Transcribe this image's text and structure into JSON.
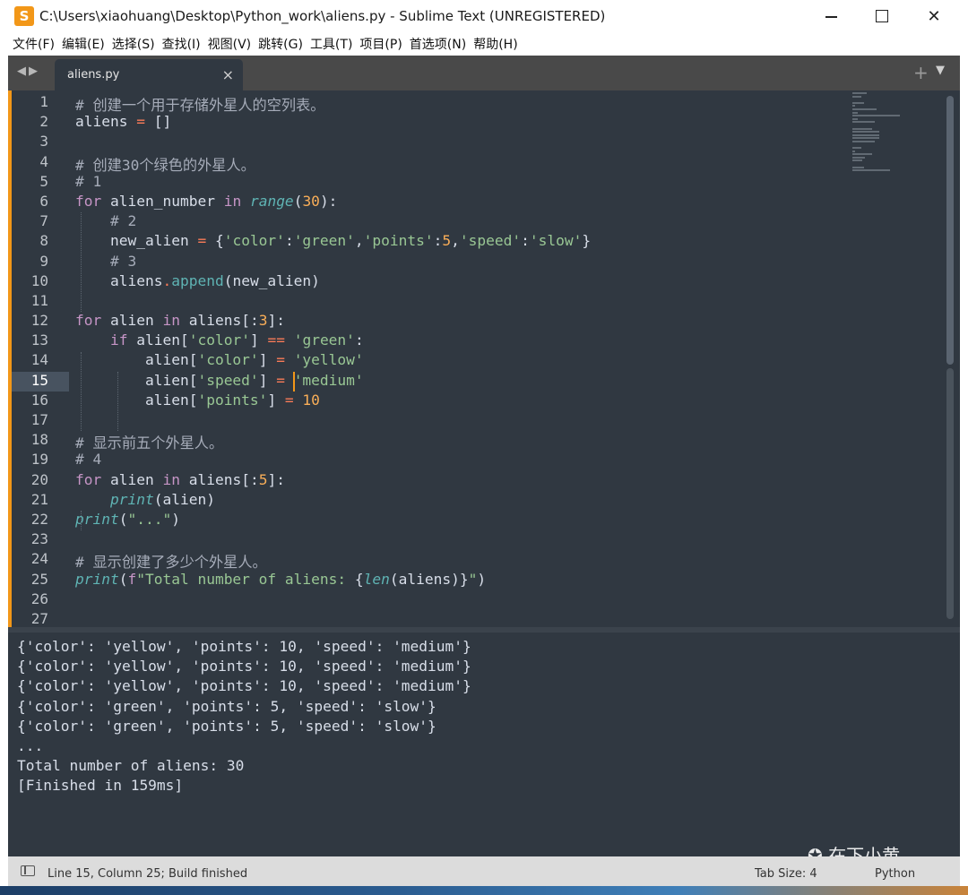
{
  "window": {
    "title": "C:\\Users\\xiaohuang\\Desktop\\Python_work\\aliens.py - Sublime Text (UNREGISTERED)",
    "app_icon": "S"
  },
  "menu": {
    "items": [
      "文件(F)",
      "编辑(E)",
      "选择(S)",
      "查找(I)",
      "视图(V)",
      "跳转(G)",
      "工具(T)",
      "项目(P)",
      "首选项(N)",
      "帮助(H)"
    ]
  },
  "tabs": [
    {
      "label": "aliens.py",
      "active": true
    }
  ],
  "editor": {
    "active_line": 15,
    "line_numbers": [
      "1",
      "2",
      "3",
      "4",
      "5",
      "6",
      "7",
      "8",
      "9",
      "10",
      "11",
      "12",
      "13",
      "14",
      "15",
      "16",
      "17",
      "18",
      "19",
      "20",
      "21",
      "22",
      "23",
      "24",
      "25",
      "26",
      "27"
    ],
    "lines": [
      [
        [
          "cm",
          "# 创建一个用于存储外星人的空列表。"
        ]
      ],
      [
        [
          "pl",
          "aliens "
        ],
        [
          "op",
          "="
        ],
        [
          "pl",
          " []"
        ]
      ],
      [],
      [
        [
          "cm",
          "# 创建30个绿色的外星人。"
        ]
      ],
      [
        [
          "cm",
          "# 1"
        ]
      ],
      [
        [
          "kw",
          "for"
        ],
        [
          "pl",
          " alien_number "
        ],
        [
          "kw",
          "in"
        ],
        [
          "pl",
          " "
        ],
        [
          "fi",
          "range"
        ],
        [
          "pl",
          "("
        ],
        [
          "nu",
          "30"
        ],
        [
          "pl",
          "):"
        ]
      ],
      [
        [
          "pl",
          "    "
        ],
        [
          "cm",
          "# 2"
        ]
      ],
      [
        [
          "pl",
          "    new_alien "
        ],
        [
          "op",
          "="
        ],
        [
          "pl",
          " {"
        ],
        [
          "st",
          "'color'"
        ],
        [
          "pl",
          ":"
        ],
        [
          "st",
          "'green'"
        ],
        [
          "pl",
          ","
        ],
        [
          "st",
          "'points'"
        ],
        [
          "pl",
          ":"
        ],
        [
          "nu",
          "5"
        ],
        [
          "pl",
          ","
        ],
        [
          "st",
          "'speed'"
        ],
        [
          "pl",
          ":"
        ],
        [
          "st",
          "'slow'"
        ],
        [
          "pl",
          "}"
        ]
      ],
      [
        [
          "pl",
          "    "
        ],
        [
          "cm",
          "# 3"
        ]
      ],
      [
        [
          "pl",
          "    aliens"
        ],
        [
          "op",
          "."
        ],
        [
          "fn",
          "append"
        ],
        [
          "pl",
          "(new_alien)"
        ]
      ],
      [],
      [
        [
          "kw",
          "for"
        ],
        [
          "pl",
          " alien "
        ],
        [
          "kw",
          "in"
        ],
        [
          "pl",
          " aliens[:"
        ],
        [
          "nu",
          "3"
        ],
        [
          "pl",
          "]:"
        ]
      ],
      [
        [
          "pl",
          "    "
        ],
        [
          "kw",
          "if"
        ],
        [
          "pl",
          " alien["
        ],
        [
          "st",
          "'color'"
        ],
        [
          "pl",
          "] "
        ],
        [
          "op",
          "=="
        ],
        [
          "pl",
          " "
        ],
        [
          "st",
          "'green'"
        ],
        [
          "pl",
          ":"
        ]
      ],
      [
        [
          "pl",
          "        alien["
        ],
        [
          "st",
          "'color'"
        ],
        [
          "pl",
          "] "
        ],
        [
          "op",
          "="
        ],
        [
          "pl",
          " "
        ],
        [
          "st",
          "'yellow'"
        ]
      ],
      [
        [
          "pl",
          "        alien["
        ],
        [
          "st",
          "'speed'"
        ],
        [
          "pl",
          "] "
        ],
        [
          "op",
          "="
        ],
        [
          "pl",
          " "
        ],
        [
          "st",
          "'medium'"
        ]
      ],
      [
        [
          "pl",
          "        alien["
        ],
        [
          "st",
          "'points'"
        ],
        [
          "pl",
          "] "
        ],
        [
          "op",
          "="
        ],
        [
          "pl",
          " "
        ],
        [
          "nu",
          "10"
        ]
      ],
      [],
      [
        [
          "cm",
          "# 显示前五个外星人。"
        ]
      ],
      [
        [
          "cm",
          "# 4"
        ]
      ],
      [
        [
          "kw",
          "for"
        ],
        [
          "pl",
          " alien "
        ],
        [
          "kw",
          "in"
        ],
        [
          "pl",
          " aliens[:"
        ],
        [
          "nu",
          "5"
        ],
        [
          "pl",
          "]:"
        ]
      ],
      [
        [
          "pl",
          "    "
        ],
        [
          "fi",
          "print"
        ],
        [
          "pl",
          "(alien)"
        ]
      ],
      [
        [
          "fi",
          "print"
        ],
        [
          "pl",
          "("
        ],
        [
          "st",
          "\"...\""
        ],
        [
          "pl",
          ")"
        ]
      ],
      [],
      [
        [
          "cm",
          "# 显示创建了多少个外星人。"
        ]
      ],
      [
        [
          "fi",
          "print"
        ],
        [
          "pl",
          "("
        ],
        [
          "kw",
          "f"
        ],
        [
          "st",
          "\"Total number of aliens: "
        ],
        [
          "pl",
          "{"
        ],
        [
          "fi",
          "len"
        ],
        [
          "pl",
          "(aliens)}"
        ],
        [
          "st",
          "\""
        ],
        [
          "pl",
          ")"
        ]
      ],
      [],
      []
    ]
  },
  "output": {
    "lines": [
      "{'color': 'yellow', 'points': 10, 'speed': 'medium'}",
      "{'color': 'yellow', 'points': 10, 'speed': 'medium'}",
      "{'color': 'yellow', 'points': 10, 'speed': 'medium'}",
      "{'color': 'green', 'points': 5, 'speed': 'slow'}",
      "{'color': 'green', 'points': 5, 'speed': 'slow'}",
      "...",
      "Total number of aliens: 30",
      "[Finished in 159ms]"
    ]
  },
  "watermark": "在下小黄",
  "status": {
    "position": "Line 15, Column 25; Build finished",
    "tab_size": "Tab Size: 4",
    "syntax": "Python"
  },
  "colors": {
    "editor_bg": "#303841",
    "accent": "#f29718",
    "comment": "#a6acb9",
    "keyword": "#c695c6",
    "function": "#5fb4b4",
    "string": "#99c794",
    "number": "#f9ae58",
    "operator": "#f97b58"
  }
}
